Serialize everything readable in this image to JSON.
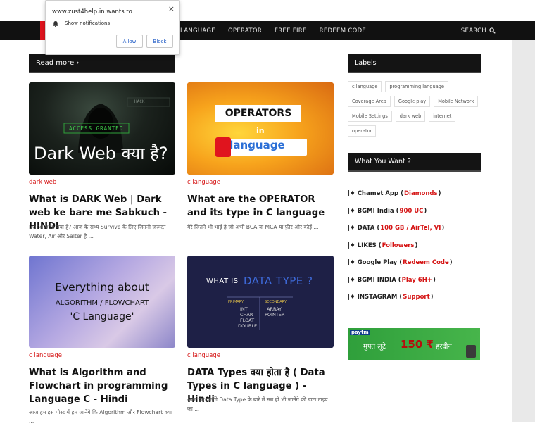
{
  "popup": {
    "title": "www.zust4help.in wants to",
    "message": "Show notifications",
    "allow": "Allow",
    "block": "Block",
    "close": "×"
  },
  "nav": {
    "items": [
      "LANGUAGE",
      "OPERATOR",
      "FREE FIRE",
      "REDEEM CODE"
    ],
    "search": "SEARCH",
    "accent_color": "#e0141e"
  },
  "main": {
    "readmore": "Read more ›",
    "posts": [
      {
        "image_text": "Dark Web क्या है?",
        "image_sub": "ACCESS GRANTED",
        "image_small": "HACK",
        "category": "dark web",
        "title": "What is DARK Web | Dark web ke bare me Sabkuch - HINDI",
        "excerpt": "Dark Web क्या है? आज के सभ्य Survive के लिए जितनी जरूरत Water, Air और Salter है ..."
      },
      {
        "image_text": "OPERATORS",
        "image_in": "in",
        "image_lang": "C language",
        "category": "c language",
        "title": "What are the OPERATOR and its type in C language",
        "excerpt": "मेरे जितने भी भाई है जो अभी BCA या MCA या फ़ीर और कोई ..."
      },
      {
        "image_line1": "Everything about",
        "image_line2": "ALGORITHM / FLOWCHART",
        "image_line3": "'C Language'",
        "category": "c language",
        "title": "What is Algorithm and Flowchart in programming Language C - Hindi",
        "excerpt": "आज हम इस पोस्ट में हम जानेंगे कि Algorithm और Flowchart क्या ..."
      },
      {
        "image_title_a": "WHAT IS",
        "image_title_b": "DATA TYPE ?",
        "image_primary": "PRIMARY",
        "image_secondary": "SECONDARY",
        "image_prim_items": [
          "INT",
          "CHAR",
          "FLOAT",
          "DOUBLE"
        ],
        "image_sec_items": [
          "ARRAY",
          "POINTER"
        ],
        "category": "c language",
        "title": "DATA Types क्या होता है ( Data Types in C language ) - Hindi",
        "excerpt": "आज हम जानेंगे Data Type के बारे में सब ही भी जानेंगे की डाटा टाइप का ..."
      }
    ]
  },
  "sidebar": {
    "labels_heading": "Labels",
    "labels": [
      "c language",
      "programming language",
      "Coverage Area",
      "Google play",
      "Mobile Network",
      "Mobile Settings",
      "dark web",
      "internet",
      "operator"
    ],
    "want_heading": "What You Want ?",
    "want_items": [
      {
        "name": "Chamet App",
        "hl": "Diamonds"
      },
      {
        "name": "BGMI India",
        "hl": "900 UC"
      },
      {
        "name": "DATA",
        "hl": "100 GB / AirTel, VI"
      },
      {
        "name": "LIKES",
        "hl": "Followers"
      },
      {
        "name": "Google Play",
        "hl": "Redeem Code"
      },
      {
        "name": "BGMI INDIA",
        "hl": "Play 6H+"
      },
      {
        "name": "INSTAGRAM",
        "hl": "Support"
      }
    ],
    "banner": {
      "brand": "paytm",
      "text_a": "मुफ्त लूटे",
      "amount": "150 ₹",
      "text_b": "हरदीन"
    }
  }
}
